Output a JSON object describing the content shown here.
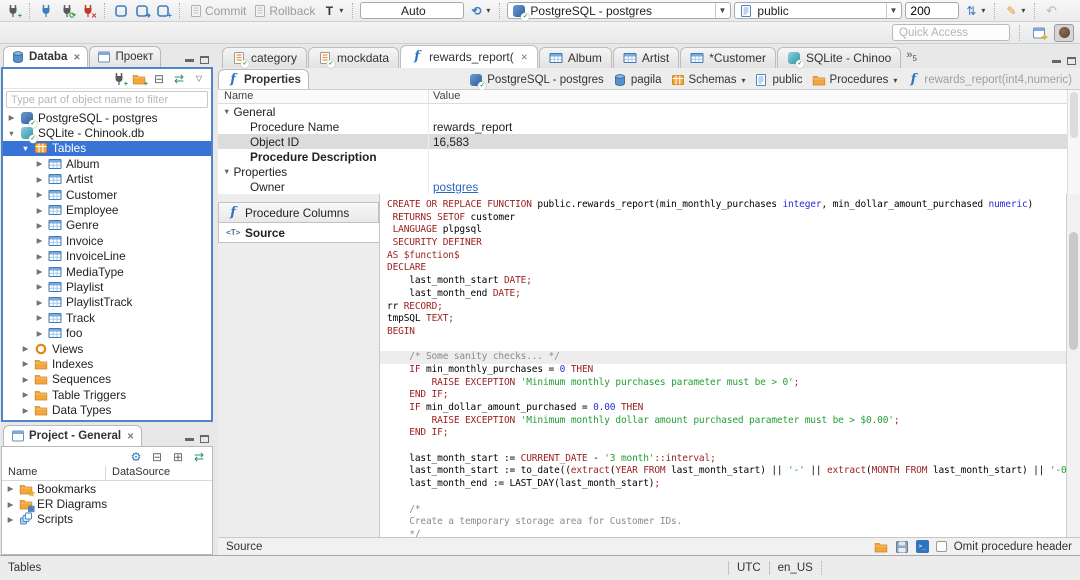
{
  "toolbar": {
    "commit_label": "Commit",
    "rollback_label": "Rollback",
    "auto_label": "Auto",
    "datasource": "PostgreSQL - postgres",
    "schema": "public",
    "fetch_size": "200",
    "quick_access_placeholder": "Quick Access"
  },
  "nav": {
    "tabs": [
      {
        "label": "Databa",
        "icon": "database",
        "active": true,
        "closable": true
      },
      {
        "label": "Проект",
        "icon": "window",
        "active": false,
        "closable": false
      }
    ],
    "filter_placeholder": "Type part of object name to filter",
    "tree": [
      {
        "label": "PostgreSQL - postgres",
        "icon": "postgres",
        "indent": 0,
        "arrow": "collapsed"
      },
      {
        "label": "SQLite - Chinook.db",
        "icon": "sqlite",
        "indent": 0,
        "arrow": "expanded"
      },
      {
        "label": "Tables",
        "icon": "tables",
        "indent": 1,
        "arrow": "expanded",
        "selected": true
      },
      {
        "label": "Album",
        "icon": "table",
        "indent": 2,
        "arrow": "collapsed"
      },
      {
        "label": "Artist",
        "icon": "table",
        "indent": 2,
        "arrow": "collapsed"
      },
      {
        "label": "Customer",
        "icon": "table",
        "indent": 2,
        "arrow": "collapsed"
      },
      {
        "label": "Employee",
        "icon": "table",
        "indent": 2,
        "arrow": "collapsed"
      },
      {
        "label": "Genre",
        "icon": "table",
        "indent": 2,
        "arrow": "collapsed"
      },
      {
        "label": "Invoice",
        "icon": "table",
        "indent": 2,
        "arrow": "collapsed"
      },
      {
        "label": "InvoiceLine",
        "icon": "table",
        "indent": 2,
        "arrow": "collapsed"
      },
      {
        "label": "MediaType",
        "icon": "table",
        "indent": 2,
        "arrow": "collapsed"
      },
      {
        "label": "Playlist",
        "icon": "table",
        "indent": 2,
        "arrow": "collapsed"
      },
      {
        "label": "PlaylistTrack",
        "icon": "table",
        "indent": 2,
        "arrow": "collapsed"
      },
      {
        "label": "Track",
        "icon": "table",
        "indent": 2,
        "arrow": "collapsed"
      },
      {
        "label": "foo",
        "icon": "table",
        "indent": 2,
        "arrow": "collapsed"
      },
      {
        "label": "Views",
        "icon": "views",
        "indent": 1,
        "arrow": "collapsed"
      },
      {
        "label": "Indexes",
        "icon": "folder",
        "indent": 1,
        "arrow": "collapsed"
      },
      {
        "label": "Sequences",
        "icon": "folder",
        "indent": 1,
        "arrow": "collapsed"
      },
      {
        "label": "Table Triggers",
        "icon": "folder",
        "indent": 1,
        "arrow": "collapsed"
      },
      {
        "label": "Data Types",
        "icon": "folder",
        "indent": 1,
        "arrow": "collapsed"
      }
    ]
  },
  "project": {
    "title": "Project - General",
    "columns": [
      "Name",
      "DataSource"
    ],
    "tree": [
      {
        "label": "Bookmarks",
        "icon": "folder-star"
      },
      {
        "label": "ER Diagrams",
        "icon": "folder-er"
      },
      {
        "label": "Scripts",
        "icon": "scripts"
      }
    ]
  },
  "editor_tabs": {
    "tabs": [
      {
        "label": "category",
        "icon": "sql-file"
      },
      {
        "label": "mockdata",
        "icon": "sql-file"
      },
      {
        "label": "rewards_report(",
        "icon": "function",
        "active": true,
        "closable": true
      },
      {
        "label": "Album",
        "icon": "table"
      },
      {
        "label": "Artist",
        "icon": "table"
      },
      {
        "label": "*Customer",
        "icon": "table"
      },
      {
        "label": "SQLite - Chinoo",
        "icon": "sqlite"
      }
    ],
    "overflow_glyph": "»",
    "overflow_count": "5"
  },
  "properties_view": {
    "tab_label": "Properties",
    "breadcrumb": [
      {
        "label": "PostgreSQL - postgres",
        "icon": "postgres"
      },
      {
        "label": "pagila",
        "icon": "database"
      },
      {
        "label": "Schemas",
        "icon": "schemas",
        "dropdown": true
      },
      {
        "label": "public",
        "icon": "schema"
      },
      {
        "label": "Procedures",
        "icon": "folder",
        "dropdown": true
      },
      {
        "label": "rewards_report(int4,numeric)",
        "icon": "function",
        "muted": true
      }
    ],
    "columns": [
      "Name",
      "Value"
    ],
    "rows": [
      {
        "name": "General",
        "group": true
      },
      {
        "name": "Procedure Name",
        "value": "rewards_report"
      },
      {
        "name": "Object ID",
        "value": "16,583",
        "selected": true
      },
      {
        "name": "Procedure Description",
        "bold": true
      },
      {
        "name": "Properties",
        "group": true
      },
      {
        "name": "Owner",
        "value": "postgres",
        "link": true
      }
    ],
    "pages": [
      {
        "label": "Procedure Columns",
        "icon": "function"
      },
      {
        "label": "Source",
        "icon": "source",
        "active": true
      }
    ]
  },
  "source": {
    "palette": {
      "keyword": "#9b1f1f",
      "text": "#000000",
      "type": "#2c2cd8",
      "number": "#2c2cd8",
      "string": "#23a034",
      "comment": "#8b8b8b",
      "current_line": "#ededed"
    },
    "lines": [
      {
        "s": [
          [
            "k",
            "CREATE OR REPLACE FUNCTION"
          ],
          [
            "t",
            " public.rewards_report(min_monthly_purchases "
          ],
          [
            "y",
            "integer"
          ],
          [
            "t",
            ", min_dollar_amount_purchased "
          ],
          [
            "y",
            "numeric"
          ],
          [
            "t",
            ")"
          ]
        ]
      },
      {
        "s": [
          [
            "t",
            " "
          ],
          [
            "k",
            "RETURNS SETOF"
          ],
          [
            "t",
            " customer"
          ]
        ]
      },
      {
        "s": [
          [
            "t",
            " "
          ],
          [
            "k",
            "LANGUAGE"
          ],
          [
            "t",
            " plpgsql"
          ]
        ]
      },
      {
        "s": [
          [
            "t",
            " "
          ],
          [
            "k",
            "SECURITY DEFINER"
          ]
        ]
      },
      {
        "s": [
          [
            "k",
            "AS"
          ],
          [
            "t",
            " "
          ],
          [
            "k",
            "$function$"
          ]
        ]
      },
      {
        "s": [
          [
            "k",
            "DECLARE"
          ]
        ]
      },
      {
        "s": [
          [
            "t",
            "    last_month_start "
          ],
          [
            "k",
            "DATE;"
          ]
        ]
      },
      {
        "s": [
          [
            "t",
            "    last_month_end "
          ],
          [
            "k",
            "DATE;"
          ]
        ]
      },
      {
        "s": [
          [
            "t",
            "rr "
          ],
          [
            "k",
            "RECORD;"
          ]
        ]
      },
      {
        "s": [
          [
            "t",
            "tmpSQL "
          ],
          [
            "k",
            "TEXT;"
          ]
        ]
      },
      {
        "s": [
          [
            "k",
            "BEGIN"
          ]
        ]
      },
      {
        "s": []
      },
      {
        "h": 1,
        "s": [
          [
            "c",
            "    /* Some sanity checks... */"
          ]
        ]
      },
      {
        "s": [
          [
            "t",
            "    "
          ],
          [
            "k",
            "IF"
          ],
          [
            "t",
            " min_monthly_purchases = "
          ],
          [
            "n",
            "0"
          ],
          [
            "t",
            " "
          ],
          [
            "k",
            "THEN"
          ]
        ]
      },
      {
        "s": [
          [
            "t",
            "        "
          ],
          [
            "k",
            "RAISE EXCEPTION"
          ],
          [
            "t",
            " "
          ],
          [
            "s2",
            "'Minimum monthly purchases parameter must be > 0'"
          ],
          [
            "k",
            ";"
          ]
        ]
      },
      {
        "s": [
          [
            "t",
            "    "
          ],
          [
            "k",
            "END IF;"
          ]
        ]
      },
      {
        "s": [
          [
            "t",
            "    "
          ],
          [
            "k",
            "IF"
          ],
          [
            "t",
            " min_dollar_amount_purchased = "
          ],
          [
            "n",
            "0.00"
          ],
          [
            "t",
            " "
          ],
          [
            "k",
            "THEN"
          ]
        ]
      },
      {
        "s": [
          [
            "t",
            "        "
          ],
          [
            "k",
            "RAISE EXCEPTION"
          ],
          [
            "t",
            " "
          ],
          [
            "s2",
            "'Minimum monthly dollar amount purchased parameter must be > $0.00'"
          ],
          [
            "k",
            ";"
          ]
        ]
      },
      {
        "s": [
          [
            "t",
            "    "
          ],
          [
            "k",
            "END IF;"
          ]
        ]
      },
      {
        "s": []
      },
      {
        "s": [
          [
            "t",
            "    last_month_start := "
          ],
          [
            "k",
            "CURRENT_DATE"
          ],
          [
            "t",
            " - "
          ],
          [
            "s2",
            "'3 month'"
          ],
          [
            "k",
            "::interval;"
          ]
        ]
      },
      {
        "s": [
          [
            "t",
            "    last_month_start := to_date(("
          ],
          [
            "k",
            "extract"
          ],
          [
            "t",
            "("
          ],
          [
            "k",
            "YEAR FROM"
          ],
          [
            "t",
            " last_month_start) || "
          ],
          [
            "s2",
            "'-'"
          ],
          [
            "t",
            " || "
          ],
          [
            "k",
            "extract"
          ],
          [
            "t",
            "("
          ],
          [
            "k",
            "MONTH FROM"
          ],
          [
            "t",
            " last_month_start) || "
          ],
          [
            "s2",
            "'-0"
          ]
        ]
      },
      {
        "s": [
          [
            "t",
            "    last_month_end := LAST_DAY(last_month_start)"
          ],
          [
            "k",
            ";"
          ]
        ]
      },
      {
        "s": []
      },
      {
        "s": [
          [
            "c",
            "    /*"
          ]
        ]
      },
      {
        "s": [
          [
            "c",
            "    Create a temporary storage area for Customer IDs."
          ]
        ]
      },
      {
        "s": [
          [
            "c",
            "    */"
          ]
        ]
      }
    ]
  },
  "editor_footer": {
    "label": "Source",
    "omit_checkbox_label": "Omit procedure header"
  },
  "statusbar": {
    "left": "Tables",
    "timezone": "UTC",
    "locale": "en_US"
  }
}
